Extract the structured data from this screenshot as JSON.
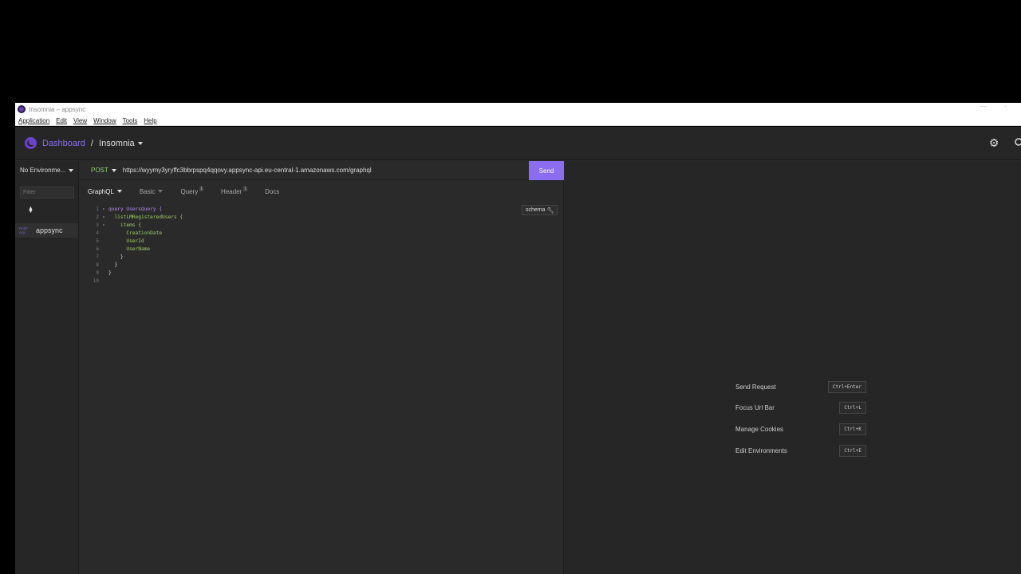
{
  "window": {
    "title": "Insomnia – appsync",
    "menu": [
      "Application",
      "Edit",
      "View",
      "Window",
      "Tools",
      "Help"
    ]
  },
  "header": {
    "dashboard_label": "Dashboard",
    "separator": "/",
    "workspace_label": "Insomnia"
  },
  "sidebar": {
    "environment": "No Environme...",
    "filter_placeholder": "Filter",
    "requests": [
      {
        "method": "POST GQL",
        "method_top": "POST",
        "method_bottom": "GQL",
        "name": "appsync"
      }
    ]
  },
  "request": {
    "method": "POST",
    "url": "https://wyymy3yryffc3bbrpspq4qqovy.appsync-api.eu-central-1.amazonaws.com/graphql",
    "send_label": "Send",
    "tabs": [
      {
        "label": "GraphQL",
        "badge": ""
      },
      {
        "label": "Basic",
        "badge": ""
      },
      {
        "label": "Query",
        "badge": "1"
      },
      {
        "label": "Header",
        "badge": "1"
      },
      {
        "label": "Docs",
        "badge": ""
      }
    ],
    "schema_label": "schema",
    "code": [
      {
        "n": "1",
        "text": "query UsersQuery {"
      },
      {
        "n": "2",
        "text": "  listLMRegisteredUsers {"
      },
      {
        "n": "3",
        "text": "    items {"
      },
      {
        "n": "4",
        "text": "      CreationDate"
      },
      {
        "n": "5",
        "text": "      UserId"
      },
      {
        "n": "6",
        "text": "      UserName"
      },
      {
        "n": "7",
        "text": "    }"
      },
      {
        "n": "8",
        "text": "  }"
      },
      {
        "n": "9",
        "text": "}"
      },
      {
        "n": "10",
        "text": ""
      }
    ]
  },
  "shortcuts": [
    {
      "label": "Send Request",
      "keys": "Ctrl+Enter"
    },
    {
      "label": "Focus Url Bar",
      "keys": "Ctrl+L"
    },
    {
      "label": "Manage Cookies",
      "keys": "Ctrl+K"
    },
    {
      "label": "Edit Environments",
      "keys": "Ctrl+E"
    }
  ],
  "colors": {
    "accent": "#8a6df0",
    "method_post": "#8cd36f",
    "background": "#2a2a2a"
  }
}
